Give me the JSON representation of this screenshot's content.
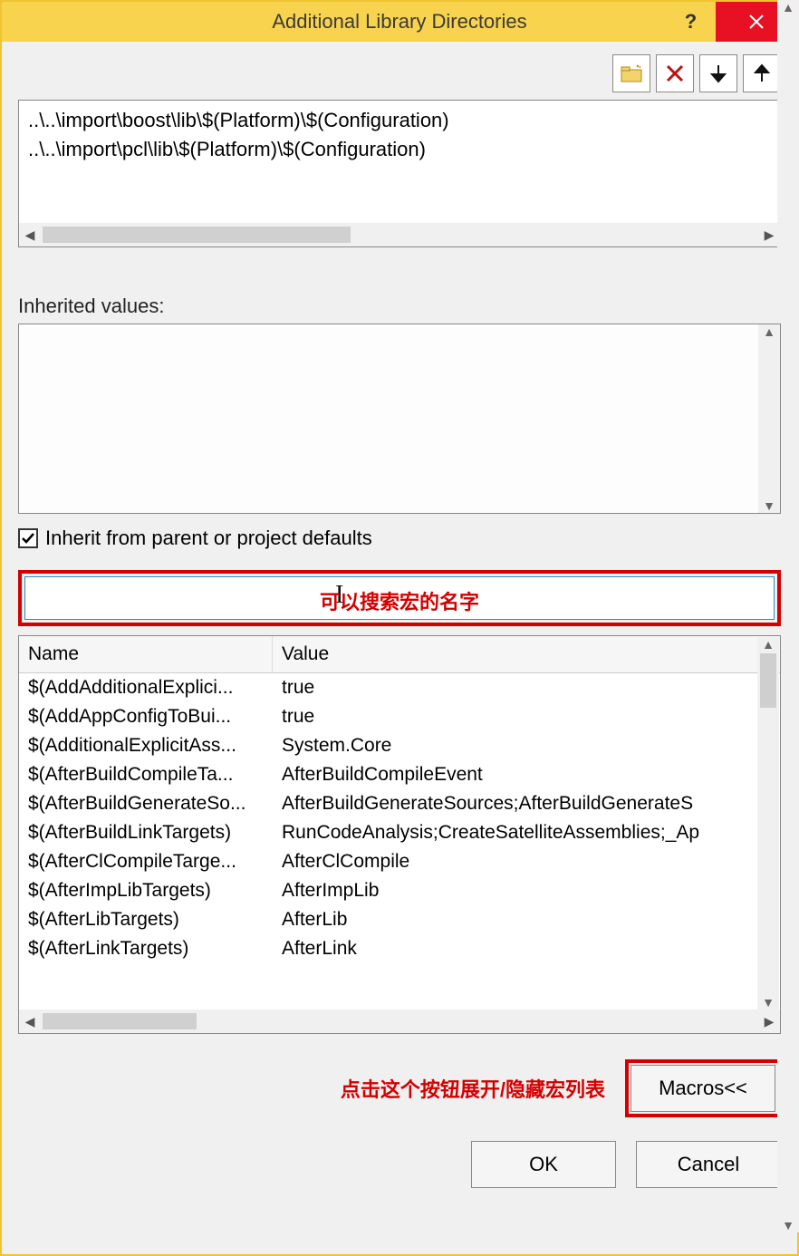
{
  "title": "Additional Library Directories",
  "directories_text": "..\\..\\import\\boost\\lib\\$(Platform)\\$(Configuration)\n..\\..\\import\\pcl\\lib\\$(Platform)\\$(Configuration)",
  "inherited_label": "Inherited values:",
  "inherit_checkbox": {
    "label": "Inherit from parent or project defaults",
    "checked": true
  },
  "search_overlay": "可以搜索宏的名字",
  "columns": {
    "name": "Name",
    "value": "Value"
  },
  "macros": [
    {
      "name": "$(AddAdditionalExplici...",
      "value": "true"
    },
    {
      "name": "$(AddAppConfigToBui...",
      "value": "true"
    },
    {
      "name": "$(AdditionalExplicitAss...",
      "value": "System.Core"
    },
    {
      "name": "$(AfterBuildCompileTa...",
      "value": "AfterBuildCompileEvent"
    },
    {
      "name": "$(AfterBuildGenerateSo...",
      "value": "AfterBuildGenerateSources;AfterBuildGenerateS"
    },
    {
      "name": "$(AfterBuildLinkTargets)",
      "value": "RunCodeAnalysis;CreateSatelliteAssemblies;_Ap"
    },
    {
      "name": "$(AfterClCompileTarge...",
      "value": "AfterClCompile"
    },
    {
      "name": "$(AfterImpLibTargets)",
      "value": "AfterImpLib"
    },
    {
      "name": "$(AfterLibTargets)",
      "value": "AfterLib"
    },
    {
      "name": "$(AfterLinkTargets)",
      "value": "AfterLink"
    }
  ],
  "macros_annot": "点击这个按钮展开/隐藏宏列表",
  "macros_button": "Macros<<",
  "ok_label": "OK",
  "cancel_label": "Cancel"
}
